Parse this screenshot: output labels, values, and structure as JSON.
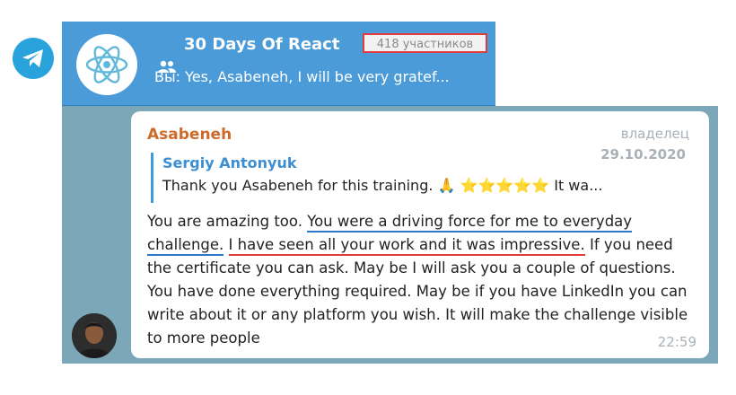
{
  "app": {
    "logo_icon": "telegram-paper-plane-icon",
    "brand_color": "#2AA3DD"
  },
  "chat_header": {
    "avatar_icon": "react-atom-icon",
    "group_icon": "people-group-icon",
    "title": "30 Days Of React",
    "member_count": "418 участников",
    "last_message": "Вы: Yes, Asabeneh, I will be very gratef...",
    "background_color": "#4A9BD8"
  },
  "message": {
    "sender": "Asabeneh",
    "role": "владелец",
    "date": "29.10.2020",
    "time": "22:59",
    "reply": {
      "author": "Sergiy Antonyuk",
      "text": "Thank you Asabeneh for this training. 🙏 ⭐⭐⭐⭐⭐ It wa..."
    },
    "text_parts": {
      "p1": "You are amazing too. ",
      "p2_highlight_blue": "You were a driving force for me to everyday challenge.",
      "p3": " ",
      "p4_highlight_red": "I have seen all your work and it was impressive.",
      "p5": " If you need the certificate you can ask. May be I will ask you a couple of questions. You have done everything required.  May be if you have LinkedIn you can write about it or any platform you wish. It will make the challenge visible to more people"
    },
    "highlight_colors": {
      "blue": "#2F77C8",
      "red": "#E03A3A"
    }
  }
}
